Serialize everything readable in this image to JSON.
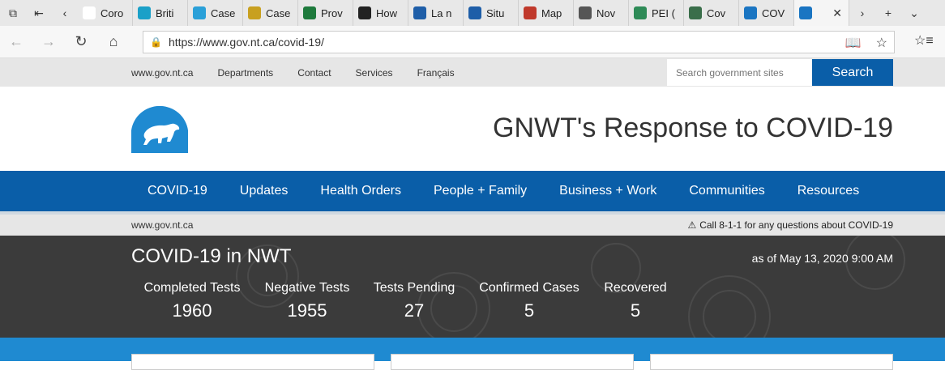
{
  "browser": {
    "tabs": [
      {
        "label": "Coro",
        "color": "#ffffff",
        "fg": "#444"
      },
      {
        "label": "Briti",
        "color": "#1aa0c8",
        "fg": "#fff"
      },
      {
        "label": "Case",
        "color": "#2aa0d8",
        "fg": "#fff"
      },
      {
        "label": "Case",
        "color": "#c8a020",
        "fg": "#fff"
      },
      {
        "label": "Prov",
        "color": "#1e7a3c",
        "fg": "#fff"
      },
      {
        "label": "How",
        "color": "#222222",
        "fg": "#fff"
      },
      {
        "label": "La n",
        "color": "#1e5ea8",
        "fg": "#fff"
      },
      {
        "label": "Situ",
        "color": "#1e5ea8",
        "fg": "#fff"
      },
      {
        "label": "Map",
        "color": "#c0392b",
        "fg": "#fff"
      },
      {
        "label": "Nov",
        "color": "#555555",
        "fg": "#fff"
      },
      {
        "label": "PEI (",
        "color": "#2e8b57",
        "fg": "#fff"
      },
      {
        "label": "Cov",
        "color": "#3a6e4a",
        "fg": "#fff"
      },
      {
        "label": "COV",
        "color": "#1a75c2",
        "fg": "#fff"
      }
    ],
    "url": "https://www.gov.nt.ca/covid-19/"
  },
  "utility": {
    "links": [
      "www.gov.nt.ca",
      "Departments",
      "Contact",
      "Services",
      "Français"
    ],
    "search_placeholder": "Search government sites",
    "search_button": "Search"
  },
  "header": {
    "title": "GNWT's Response to COVID-19"
  },
  "nav": [
    "COVID-19",
    "Updates",
    "Health Orders",
    "People + Family",
    "Business + Work",
    "Communities",
    "Resources"
  ],
  "breadcrumb": "www.gov.nt.ca",
  "alert": "Call 8-1-1 for any questions about COVID-19",
  "stats": {
    "title": "COVID-19 in NWT",
    "as_of": "as of May 13, 2020 9:00 AM",
    "items": [
      {
        "label": "Completed Tests",
        "value": "1960"
      },
      {
        "label": "Negative Tests",
        "value": "1955"
      },
      {
        "label": "Tests Pending",
        "value": "27"
      },
      {
        "label": "Confirmed Cases",
        "value": "5"
      },
      {
        "label": "Recovered",
        "value": "5"
      }
    ]
  },
  "colors": {
    "brand_blue": "#0a5ea8",
    "band_blue": "#1f8ad1",
    "stats_bg": "#3b3b3b"
  }
}
